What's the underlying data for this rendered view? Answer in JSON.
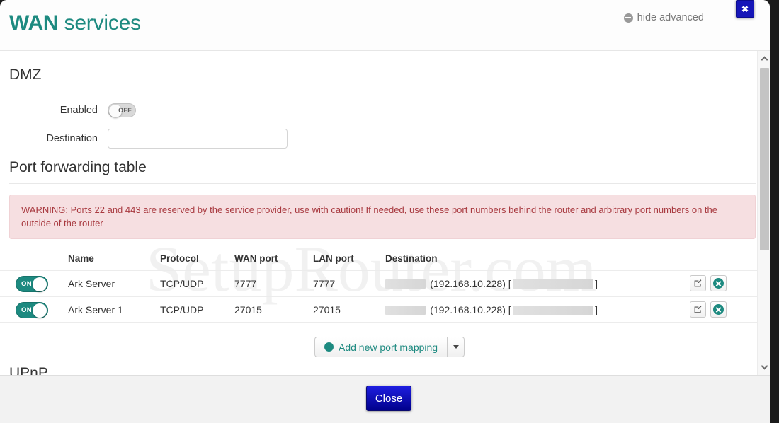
{
  "header": {
    "title_bold": "WAN",
    "title_rest": " services",
    "hide_advanced_label": "hide advanced",
    "hide_advanced_icon": "minus-circle-icon",
    "close_icon": "close-x-icon",
    "accent_color": "#1d8a80",
    "close_button_color": "#1616b8"
  },
  "dmz": {
    "section_title": "DMZ",
    "enabled_label": "Enabled",
    "enabled_state": "OFF",
    "destination_label": "Destination",
    "destination_value": "",
    "destination_placeholder": ""
  },
  "port_forwarding": {
    "section_title": "Port forwarding table",
    "warning": "WARNING: Ports 22 and 443 are reserved by the service provider, use with caution! If needed, use these port numbers behind the router and arbitrary port numbers on the outside of the router",
    "warning_bg": "#f6dfe1",
    "warning_text_color": "#a8393f",
    "columns": [
      "Name",
      "Protocol",
      "WAN port",
      "LAN port",
      "Destination"
    ],
    "rows": [
      {
        "enabled_state": "ON",
        "name": "Ark Server",
        "protocol": "TCP/UDP",
        "wan_port": "7777",
        "lan_port": "7777",
        "destination_ip": "(192.168.10.228) [",
        "destination_close": "]",
        "edit_icon": "edit-pencil-icon",
        "delete_icon": "delete-circle-x-icon"
      },
      {
        "enabled_state": "ON",
        "name": "Ark Server 1",
        "protocol": "TCP/UDP",
        "wan_port": "27015",
        "lan_port": "27015",
        "destination_ip": "(192.168.10.228) [",
        "destination_close": "]",
        "edit_icon": "edit-pencil-icon",
        "delete_icon": "delete-circle-x-icon"
      }
    ],
    "add_button_label": "Add new port mapping",
    "add_button_icon": "plus-circle-icon",
    "add_dropdown_icon": "chevron-down-icon"
  },
  "upnp": {
    "section_title": "UPnP"
  },
  "footer": {
    "close_label": "Close"
  },
  "watermark": {
    "text": "SetupRouter.com"
  },
  "scrollbar": {
    "up_icon": "chevron-up-icon",
    "down_icon": "chevron-down-icon"
  }
}
